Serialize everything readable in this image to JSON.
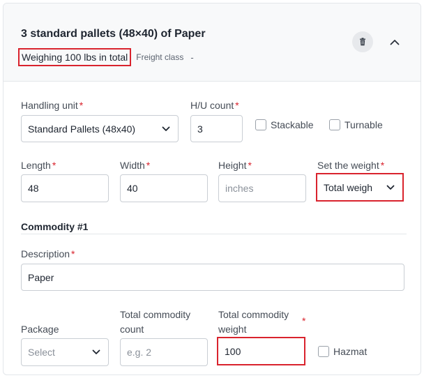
{
  "header": {
    "title": "3 standard pallets (48×40) of Paper",
    "weighing_text": "Weighing 100 lbs in total",
    "freight_class_label": "Freight class",
    "freight_class_value": "-",
    "delete_icon": "trash-icon",
    "collapse_icon": "chevron-up-icon"
  },
  "handling": {
    "unit_label": "Handling unit",
    "unit_value": "Standard Pallets (48x40)",
    "count_label": "H/U count",
    "count_value": "3",
    "stackable_label": "Stackable",
    "turnable_label": "Turnable"
  },
  "dimensions": {
    "length_label": "Length",
    "length_value": "48",
    "width_label": "Width",
    "width_value": "40",
    "height_label": "Height",
    "height_placeholder": "inches",
    "weight_mode_label": "Set the weight",
    "weight_mode_value": "Total weigh"
  },
  "commodity": {
    "section_title": "Commodity #1",
    "description_label": "Description",
    "description_value": "Paper",
    "package_label": "Package",
    "package_placeholder": "Select",
    "count_label_line1": "Total commodity",
    "count_label_line2": "count",
    "count_placeholder": "e.g. 2",
    "weight_label_line1": "Total commodity",
    "weight_label_line2": "weight",
    "weight_value": "100",
    "hazmat_label": "Hazmat"
  },
  "required_marker": "*",
  "colors": {
    "highlight": "#d9232d",
    "required": "#d9232d",
    "header_bg": "#f8f9fa"
  }
}
